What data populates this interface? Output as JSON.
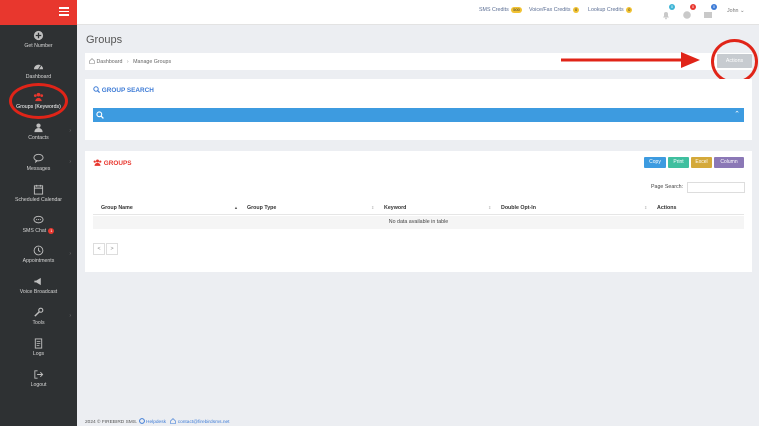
{
  "sidebar": {
    "items": [
      {
        "label": "Get Number",
        "icon": "plus-circle-icon"
      },
      {
        "label": "Dashboard",
        "icon": "dashboard-icon"
      },
      {
        "label": "Groups (Keywords)",
        "icon": "users-icon"
      },
      {
        "label": "Contacts",
        "icon": "contact-icon"
      },
      {
        "label": "Messages",
        "icon": "chat-icon"
      },
      {
        "label": "Scheduled Calendar",
        "icon": "calendar-icon"
      },
      {
        "label": "SMS Chat",
        "icon": "sms-chat-icon",
        "badge": "1"
      },
      {
        "label": "Appointments",
        "icon": "clock-icon"
      },
      {
        "label": "Voice Broadcast",
        "icon": "megaphone-icon"
      },
      {
        "label": "Tools",
        "icon": "wrench-icon"
      },
      {
        "label": "Logs",
        "icon": "log-icon"
      },
      {
        "label": "Logout",
        "icon": "logout-icon"
      }
    ]
  },
  "topbar": {
    "sms_credits_label": "SMS Credits",
    "sms_credits_value": "500",
    "voice_fax_label": "Voice/Fax Credits",
    "voice_fax_value": "0",
    "lookup_label": "Lookup Credits",
    "lookup_value": "0",
    "notif_badges": [
      "0",
      "0",
      "0"
    ],
    "user_name": "John"
  },
  "page": {
    "title": "Groups",
    "breadcrumb": [
      "Dashboard",
      "Manage Groups"
    ],
    "actions_label": "Actions"
  },
  "search_panel": {
    "title": "GROUP SEARCH"
  },
  "groups_panel": {
    "title": "GROUPS",
    "buttons": [
      "Copy",
      "Print",
      "Excel",
      "Column"
    ],
    "page_search_label": "Page Search:",
    "columns": [
      "Group Name",
      "Group Type",
      "Keyword",
      "Double Opt-In",
      "Actions"
    ],
    "empty_text": "No data available in table",
    "pager": [
      "<",
      ">"
    ]
  },
  "footer": {
    "copyright": "2024 © FIREBIRD SMS.",
    "helpdesk": "Helpdesk",
    "email": "contact@firebirdsms.net"
  },
  "colors": {
    "brand_red": "#e8372e",
    "sidebar_bg": "#2e3133",
    "info_blue": "#3d9be0",
    "copy_btn": "#3d9be0",
    "print_btn": "#3fbf9f",
    "excel_btn": "#d4a93a",
    "column_btn": "#8b78b6"
  }
}
